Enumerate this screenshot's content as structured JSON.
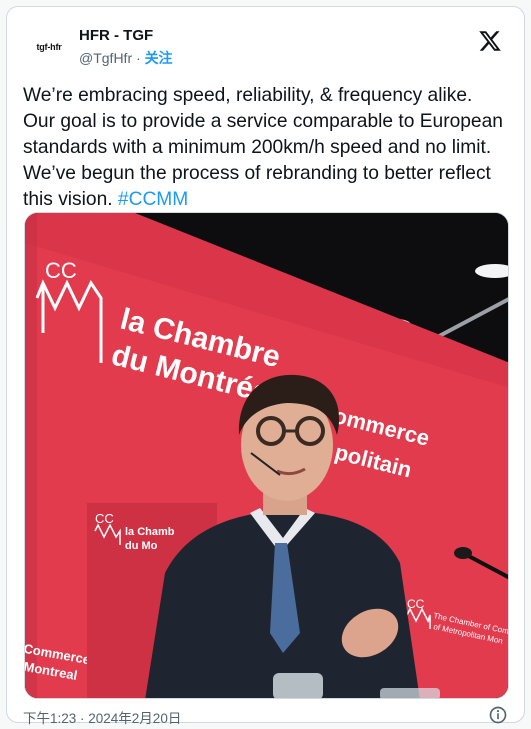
{
  "author": {
    "name": "HFR - TGF",
    "handle": "@TgfHfr",
    "separator": " · ",
    "follow_label": "关注",
    "avatar_text": "tgf-hfr"
  },
  "tweet": {
    "text": "We’re embracing speed, reliability, & frequency alike. Our goal is to provide a service comparable to European standards with a minimum 200km/h speed and no limit. We’ve begun the process of rebranding to better reflect this vision. ",
    "hashtag": "#CCMM"
  },
  "media": {
    "backdrop_logo": "CC",
    "backdrop_title_line1": "la Chambre",
    "backdrop_title_line1b": "ommerce",
    "backdrop_title_line2": "du Montréa",
    "backdrop_title_line2b": "politain",
    "podium_logo": "CC",
    "podium_text_line1": "la Chamb",
    "podium_text_line2": "du Mo",
    "side_logo": "CC",
    "side_text_line1": "The Chamber of Com",
    "side_text_line2": "of Metropolitan Mon",
    "left_text_line1": "Commerce",
    "left_text_line2": "Montreal"
  },
  "timestamp": "下午1:23 · 2024年2月20日",
  "icons": {
    "x_logo": "x-logo-icon",
    "info": "info-icon"
  },
  "colors": {
    "accent": "#1d9bf0",
    "backdrop_red": "#e23b4e",
    "text_primary": "#0f1419",
    "text_secondary": "#536471"
  }
}
